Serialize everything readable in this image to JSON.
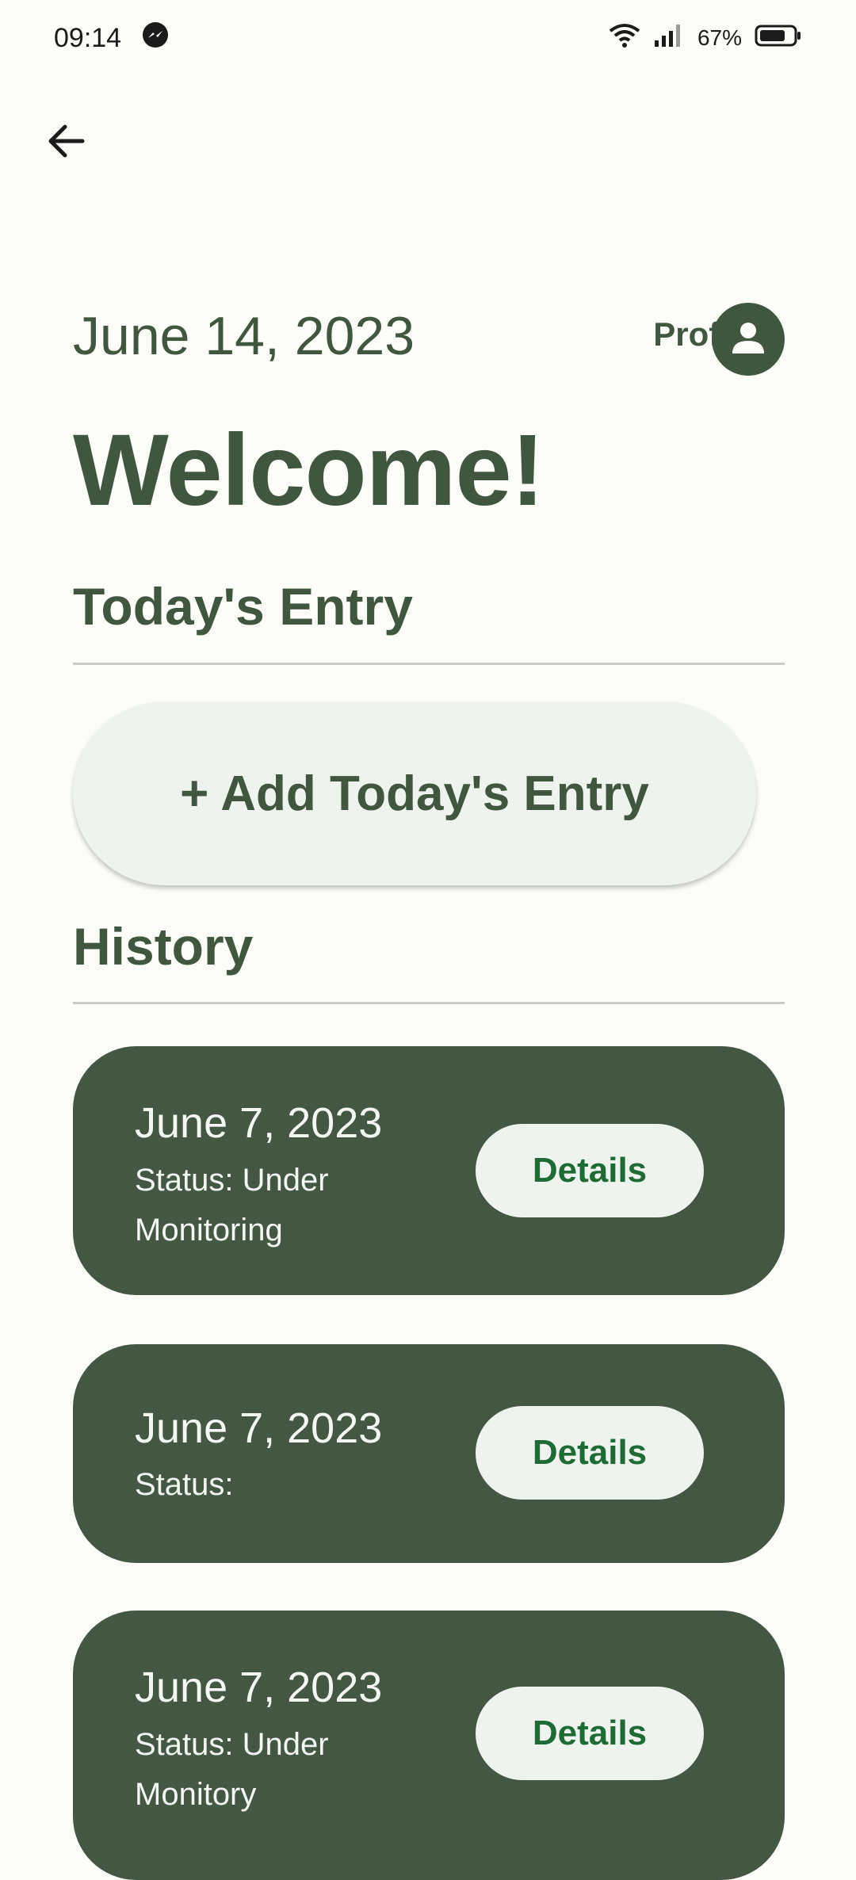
{
  "status_bar": {
    "time": "09:14",
    "app_icon": "messenger-icon",
    "battery_percent": "67%",
    "icons": [
      "wifi-icon",
      "signal-icon",
      "battery-icon"
    ]
  },
  "nav": {
    "back_icon": "arrow-back-icon"
  },
  "header": {
    "date": "June 14, 2023",
    "profile_label": "Profile",
    "profile_icon": "person-icon",
    "welcome": "Welcome!"
  },
  "today": {
    "title": "Today's Entry",
    "add_button": "+ Add Today's Entry"
  },
  "history": {
    "title": "History",
    "items": [
      {
        "date": "June 7, 2023",
        "status": "Status: Under Monitoring",
        "button": "Details"
      },
      {
        "date": "June 7, 2023",
        "status": "Status:",
        "button": "Details"
      },
      {
        "date": "June 7, 2023",
        "status": "Status: Under Monitory",
        "button": "Details"
      }
    ]
  },
  "colors": {
    "background": "#FCFDF8",
    "primary": "#41563F",
    "card": "#435743",
    "button_bg": "#EFF3EE",
    "button_text": "#1F6B35"
  }
}
